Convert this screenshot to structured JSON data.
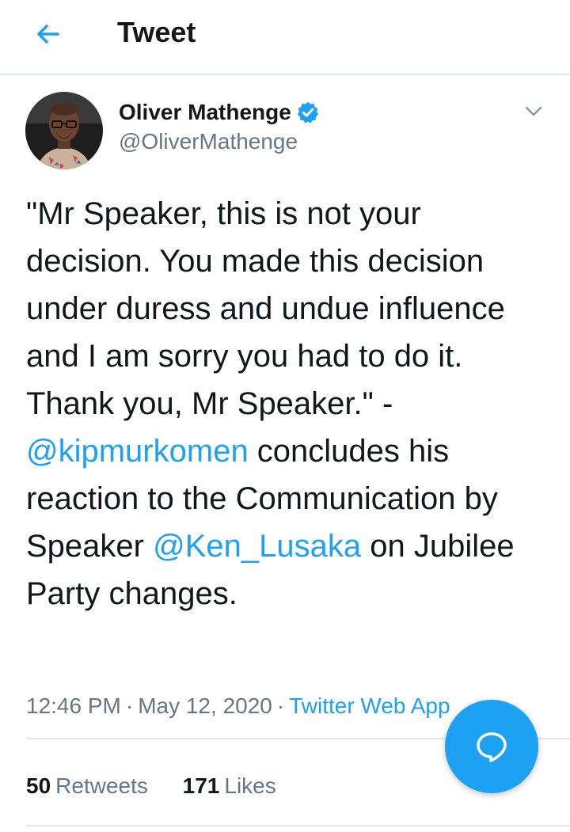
{
  "header": {
    "title": "Tweet",
    "back_icon": "arrow-left-icon"
  },
  "author": {
    "name": "Oliver Mathenge",
    "handle": "@OliverMathenge",
    "verified": true,
    "avatar_icon": "avatar"
  },
  "tweet": {
    "text_part1": "\"Mr Speaker, this is not your decision. You made this decision under duress and undue influence and I am sorry you had to do it. Thank you, Mr Speaker.\" - ",
    "mention1": "@kipmurkomen",
    "text_part2": " concludes his reaction to the Communication by Speaker ",
    "mention2": "@Ken_Lusaka",
    "text_part3": " on Jubilee Party changes."
  },
  "meta": {
    "time": "12:46 PM",
    "date": "May 12, 2020",
    "source": "Twitter Web App",
    "separator": "·"
  },
  "stats": {
    "retweets_count": "50",
    "retweets_label": "Retweets",
    "likes_count": "171",
    "likes_label": "Likes"
  },
  "fab": {
    "icon": "reply-bubble-icon"
  },
  "colors": {
    "accent": "#1da1f2",
    "text": "#14171a",
    "secondary": "#657786",
    "divider": "#e1e8ed"
  }
}
